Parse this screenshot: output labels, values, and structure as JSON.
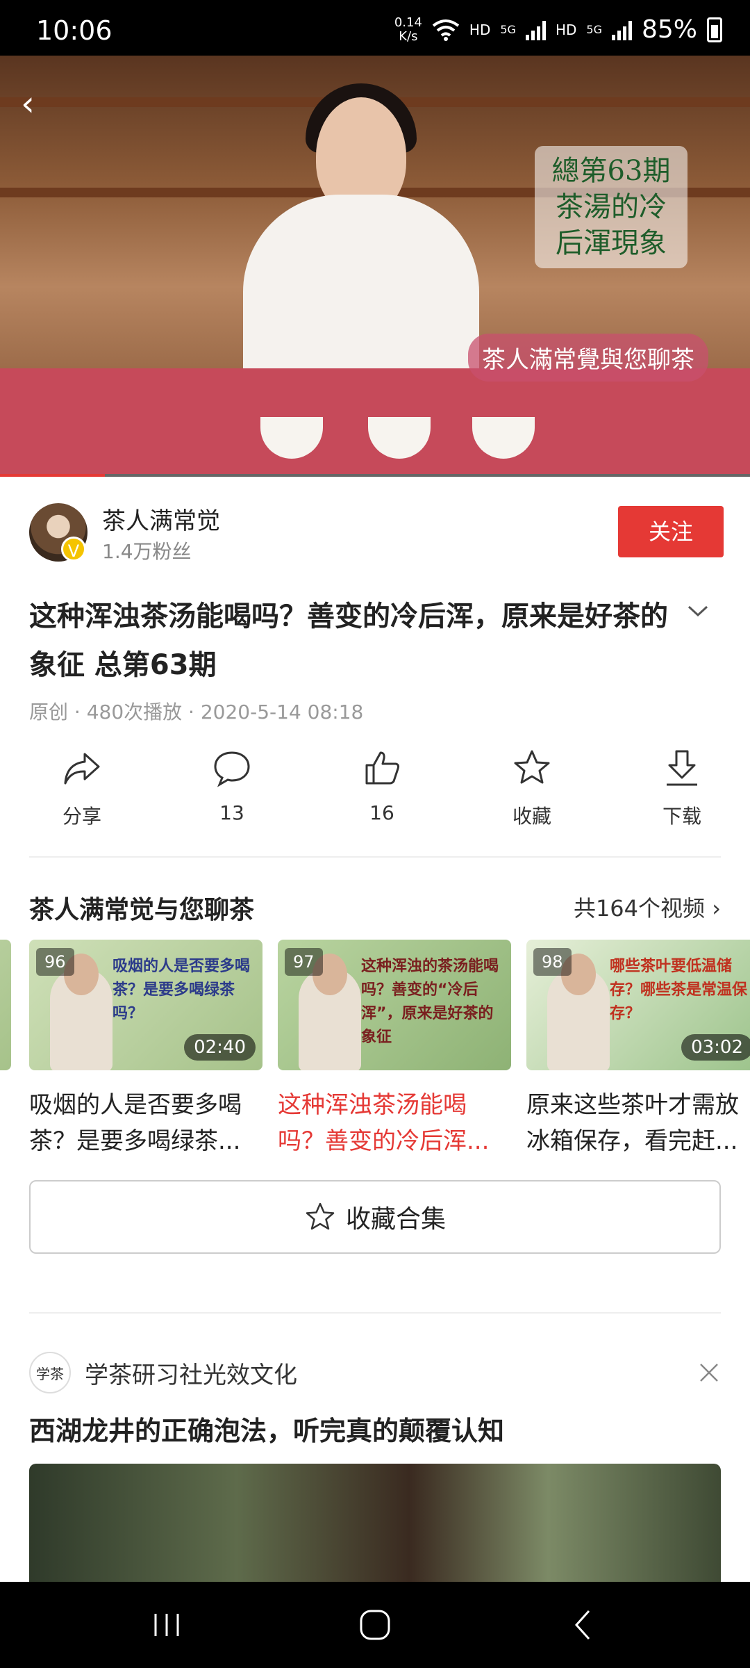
{
  "status_bar": {
    "time": "10:06",
    "net_speed_value": "0.14",
    "net_speed_unit": "K/s",
    "hd1": "HD",
    "sig1": "5G",
    "hd2": "HD",
    "sig2": "5G",
    "battery": "85%"
  },
  "video": {
    "overlay_title": "總第63期\n茶湯的冷\n后渾現象",
    "overlay_sub": "茶人滿常覺與您聊茶",
    "progress": 0.14
  },
  "author": {
    "name": "茶人满常觉",
    "fans": "1.4万粉丝",
    "follow_label": "关注",
    "badge": "V"
  },
  "title": "这种浑浊茶汤能喝吗？善变的冷后浑，原来是好茶的象征 总第63期",
  "meta": "原创 · 480次播放 · 2020-5-14 08:18",
  "actions": [
    {
      "icon": "share-icon",
      "label": "分享"
    },
    {
      "icon": "comment-icon",
      "label": "13"
    },
    {
      "icon": "like-icon",
      "label": "16"
    },
    {
      "icon": "favorite-icon",
      "label": "收藏"
    },
    {
      "icon": "download-icon",
      "label": "下载"
    }
  ],
  "collection": {
    "title": "茶人满常觉与您聊茶",
    "count": "共164个视频",
    "items": [
      {
        "num": "96",
        "duration": "02:40",
        "thumb_text": "吸烟的人是否要多喝茶？是要多喝绿茶吗？",
        "caption": "吸烟的人是否要多喝茶？是要多喝绿茶...",
        "active": false
      },
      {
        "num": "97",
        "duration": "",
        "thumb_text": "这种浑浊的茶汤能喝吗？善变的“冷后浑”，原来是好茶的象征",
        "caption": "这种浑浊茶汤能喝吗？善变的冷后浑...",
        "active": true
      },
      {
        "num": "98",
        "duration": "03:02",
        "thumb_text": "哪些茶叶要低温储存？哪些茶是常温保存？",
        "caption": "原来这些茶叶才需放冰箱保存，看完赶...",
        "active": false
      }
    ],
    "collect_label": "收藏合集"
  },
  "feed": {
    "author_name": "学茶研习社光效文化",
    "avatar_text": "学茶",
    "title": "西湖龙井的正确泡法，听完真的颠覆认知"
  },
  "colors": {
    "accent": "#e53935",
    "meta_gray": "#999999"
  }
}
